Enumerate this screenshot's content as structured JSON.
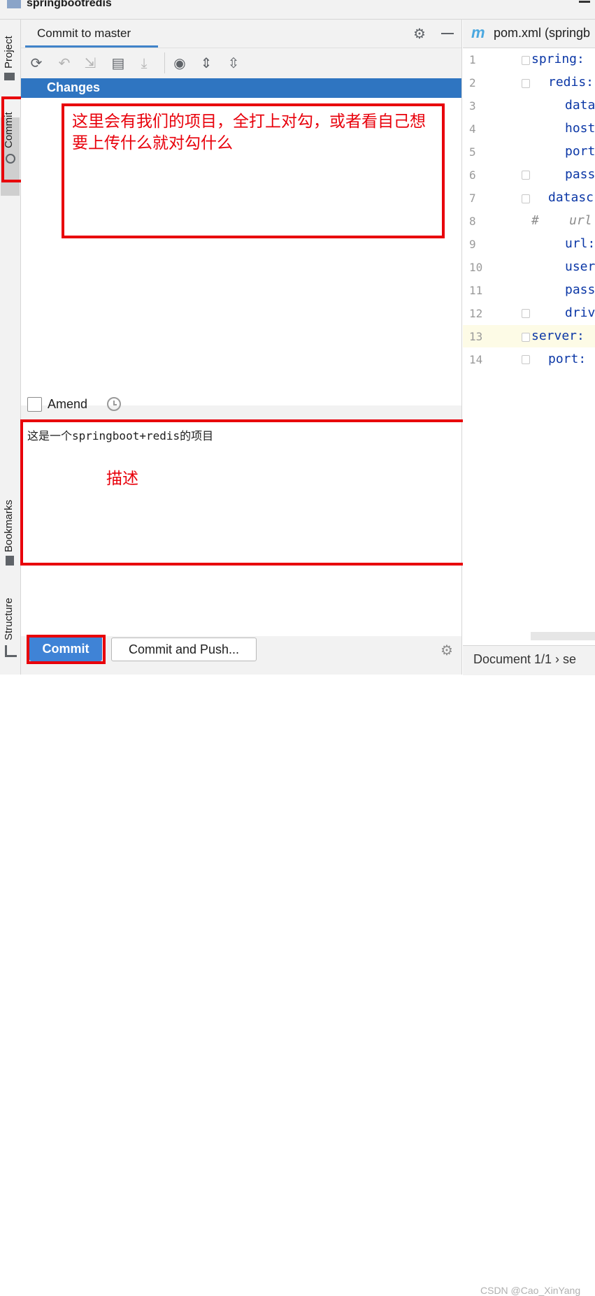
{
  "window": {
    "title": "springbootredis"
  },
  "left_stripe": {
    "project": "Project",
    "commit": "Commit",
    "bookmarks": "Bookmarks",
    "structure": "Structure"
  },
  "commit_panel": {
    "tab_label": "Commit to master",
    "changes_header": "Changes",
    "amend_label": "Amend",
    "message": "这是一个springboot+redis的项目",
    "commit_button": "Commit",
    "commit_push_button": "Commit and Push..."
  },
  "annotations": {
    "changes_note": "这里会有我们的项目，全打上对勾，或者看自己想要上传什么就对勾什么",
    "message_note": "描述"
  },
  "editor": {
    "tab_label": "pom.xml (springb",
    "lines": [
      {
        "n": "1",
        "text": "spring:"
      },
      {
        "n": "2",
        "text": "redis:"
      },
      {
        "n": "3",
        "text": "data"
      },
      {
        "n": "4",
        "text": "host"
      },
      {
        "n": "5",
        "text": "port"
      },
      {
        "n": "6",
        "text": "pass"
      },
      {
        "n": "7",
        "text": "datasc"
      },
      {
        "n": "8",
        "text": "#    url"
      },
      {
        "n": "9",
        "text": "url:"
      },
      {
        "n": "10",
        "text": "user"
      },
      {
        "n": "11",
        "text": "pass"
      },
      {
        "n": "12",
        "text": "driv"
      },
      {
        "n": "13",
        "text": "server:"
      },
      {
        "n": "14",
        "text": "port:"
      }
    ],
    "status": "Document 1/1  ›  se"
  },
  "watermark": "CSDN @Cao_XinYang",
  "colors": {
    "accent": "#2f75c1",
    "annotation": "#e8000b",
    "button": "#3f83d6"
  }
}
